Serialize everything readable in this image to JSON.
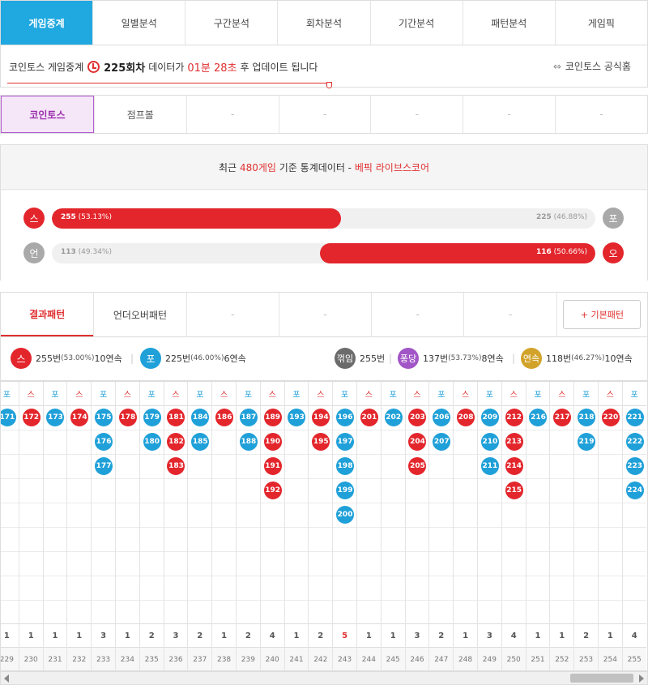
{
  "nav": {
    "tabs": [
      "게임중계",
      "일별분석",
      "구간분석",
      "회차분석",
      "기간분석",
      "패턴분석",
      "게임픽"
    ]
  },
  "update": {
    "prefix": "코인토스 게임중계",
    "round": "225회차",
    "mid": "데이터가",
    "time": "01분 28초",
    "suffix": "후 업데이트 됩니다",
    "site_link": "코인토스 공식홈",
    "site_icon": "coin-link-icon"
  },
  "games": {
    "tabs": [
      "코인토스",
      "점프볼",
      "-",
      "-",
      "-",
      "-",
      "-"
    ]
  },
  "stats": {
    "header_prefix": "최근",
    "header_games": "480게임",
    "header_mid": "기준 통계데이터 -",
    "header_brand": "베픽 라이브스코어",
    "bars": [
      {
        "left_symbol": "스",
        "right_symbol": "포",
        "left_label": "255",
        "left_pct": "(53.13%)",
        "right_label": "225",
        "right_pct": "(46.88%)",
        "fill_side": "left",
        "fill_fraction": 0.5313,
        "left_color": "#e3262c",
        "right_color": "#a9a9a9"
      },
      {
        "left_symbol": "언",
        "right_symbol": "오",
        "left_label": "113",
        "left_pct": "(49.34%)",
        "right_label": "116",
        "right_pct": "(50.66%)",
        "fill_side": "right",
        "fill_fraction": 0.5066,
        "left_color": "#a9a9a9",
        "right_color": "#e3262c"
      }
    ]
  },
  "pattern_tabs": {
    "tabs": [
      "결과패턴",
      "언더오버패턴",
      "-",
      "-",
      "-",
      "-"
    ],
    "basic_button": "+ 기본패턴"
  },
  "summary": [
    {
      "symbol": "스",
      "color": "#e3262c",
      "count": "255번",
      "pct": "(53.00%)",
      "streak": "10연속"
    },
    {
      "symbol": "포",
      "color": "#1fa0d8",
      "count": "225번",
      "pct": "(46.00%)",
      "streak": "6연속"
    },
    {
      "symbol": "꺾임",
      "color": "#6b6b6b",
      "count": "255번",
      "pct": "",
      "streak": ""
    },
    {
      "symbol": "퐁당",
      "color": "#a155c6",
      "count": "137번",
      "pct": "(53.73%)",
      "streak": "8연속"
    },
    {
      "symbol": "연속",
      "color": "#d2a32b",
      "count": "118번",
      "pct": "(46.27%)",
      "streak": "10연속"
    }
  ],
  "chart_data": {
    "type": "table",
    "columns": [
      {
        "side": "포",
        "header": "포",
        "balls": [
          "171"
        ],
        "count": "1",
        "round": "229"
      },
      {
        "side": "스",
        "header": "스",
        "balls": [
          "172"
        ],
        "count": "1",
        "round": "230"
      },
      {
        "side": "포",
        "header": "포",
        "balls": [
          "173"
        ],
        "count": "1",
        "round": "231"
      },
      {
        "side": "스",
        "header": "스",
        "balls": [
          "174"
        ],
        "count": "1",
        "round": "232"
      },
      {
        "side": "포",
        "header": "포",
        "balls": [
          "175",
          "176",
          "177"
        ],
        "count": "3",
        "round": "233"
      },
      {
        "side": "스",
        "header": "스",
        "balls": [
          "178"
        ],
        "count": "1",
        "round": "234"
      },
      {
        "side": "포",
        "header": "포",
        "balls": [
          "179",
          "180"
        ],
        "count": "2",
        "round": "235"
      },
      {
        "side": "스",
        "header": "스",
        "balls": [
          "181",
          "182",
          "183"
        ],
        "count": "3",
        "round": "236"
      },
      {
        "side": "포",
        "header": "포",
        "balls": [
          "184",
          "185"
        ],
        "count": "2",
        "round": "237"
      },
      {
        "side": "스",
        "header": "스",
        "balls": [
          "186"
        ],
        "count": "1",
        "round": "238"
      },
      {
        "side": "포",
        "header": "포",
        "balls": [
          "187",
          "188"
        ],
        "count": "2",
        "round": "239"
      },
      {
        "side": "스",
        "header": "스",
        "balls": [
          "189",
          "190",
          "191",
          "192"
        ],
        "count": "4",
        "round": "240"
      },
      {
        "side": "포",
        "header": "포",
        "balls": [
          "193"
        ],
        "count": "1",
        "round": "241"
      },
      {
        "side": "스",
        "header": "스",
        "balls": [
          "194",
          "195"
        ],
        "count": "2",
        "round": "242"
      },
      {
        "side": "포",
        "header": "포",
        "balls": [
          "196",
          "197",
          "198",
          "199",
          "200"
        ],
        "count": "5",
        "round": "243",
        "highlight": true
      },
      {
        "side": "스",
        "header": "스",
        "balls": [
          "201"
        ],
        "count": "1",
        "round": "244"
      },
      {
        "side": "포",
        "header": "포",
        "balls": [
          "202"
        ],
        "count": "1",
        "round": "245"
      },
      {
        "side": "스",
        "header": "스",
        "balls": [
          "203",
          "204",
          "205"
        ],
        "count": "3",
        "round": "246"
      },
      {
        "side": "포",
        "header": "포",
        "balls": [
          "206",
          "207"
        ],
        "count": "2",
        "round": "247"
      },
      {
        "side": "스",
        "header": "스",
        "balls": [
          "208"
        ],
        "count": "1",
        "round": "248"
      },
      {
        "side": "포",
        "header": "포",
        "balls": [
          "209",
          "210",
          "211"
        ],
        "count": "3",
        "round": "249"
      },
      {
        "side": "스",
        "header": "스",
        "balls": [
          "212",
          "213",
          "214",
          "215"
        ],
        "count": "4",
        "round": "250"
      },
      {
        "side": "포",
        "header": "포",
        "balls": [
          "216"
        ],
        "count": "1",
        "round": "251"
      },
      {
        "side": "스",
        "header": "스",
        "balls": [
          "217"
        ],
        "count": "1",
        "round": "252"
      },
      {
        "side": "포",
        "header": "포",
        "balls": [
          "218",
          "219"
        ],
        "count": "2",
        "round": "253"
      },
      {
        "side": "스",
        "header": "스",
        "balls": [
          "220"
        ],
        "count": "1",
        "round": "254"
      },
      {
        "side": "포",
        "header": "포",
        "balls": [
          "221",
          "222",
          "223",
          "224"
        ],
        "count": "4",
        "round": "255"
      }
    ]
  }
}
